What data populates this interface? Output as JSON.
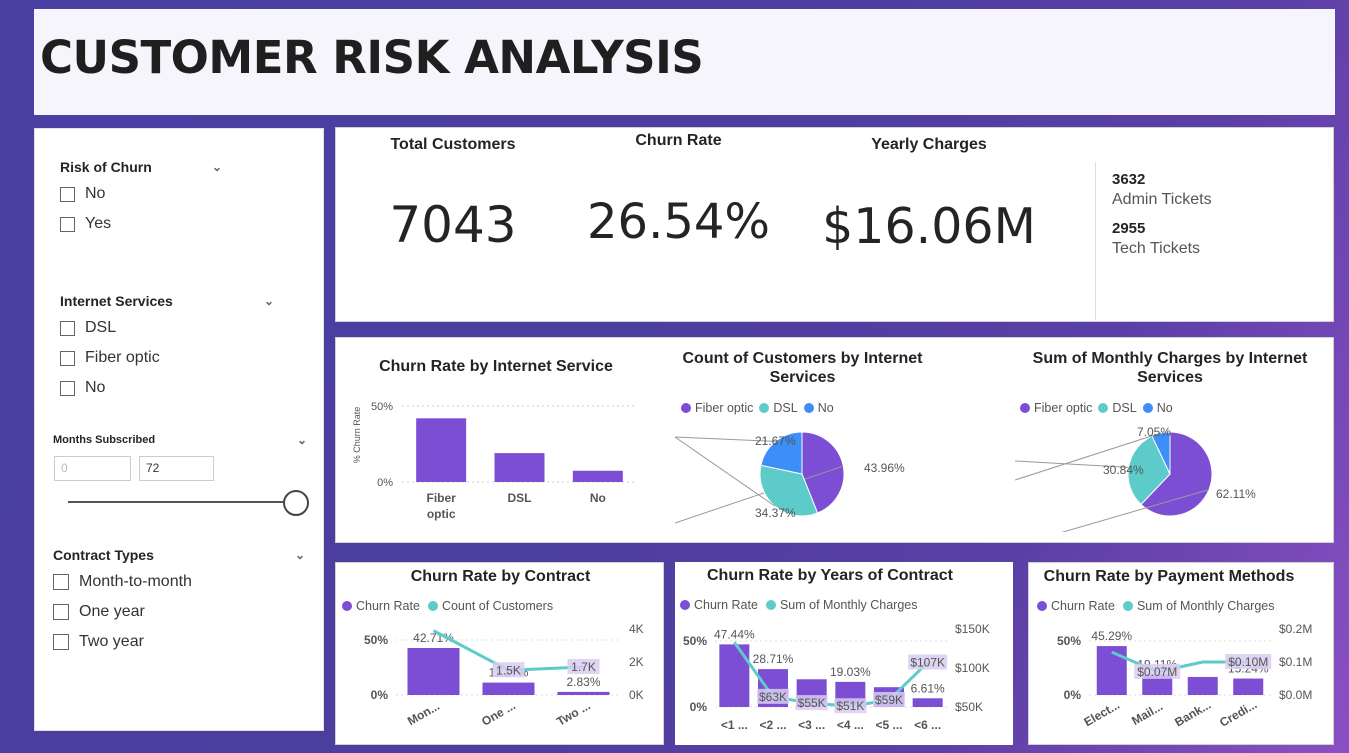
{
  "header": {
    "title": "CUSTOMER RISK ANALYSIS"
  },
  "colors": {
    "purple": "#7b4ed3",
    "teal": "#5ccbc9",
    "blue": "#3e8ef7",
    "lavender": "#d9cdf1"
  },
  "filters": {
    "risk": {
      "title": "Risk of Churn",
      "items": [
        "No",
        "Yes"
      ]
    },
    "internet": {
      "title": "Internet Services",
      "items": [
        "DSL",
        "Fiber optic",
        "No"
      ]
    },
    "months": {
      "title": "Months Subscribed",
      "min_placeholder": "0",
      "max_value": "72"
    },
    "contract": {
      "title": "Contract Types",
      "items": [
        "Month-to-month",
        "One year",
        "Two year"
      ]
    }
  },
  "kpis": {
    "total_customers": {
      "label": "Total Customers",
      "value": "7043"
    },
    "churn_rate": {
      "label": "Churn Rate",
      "value": "26.54%"
    },
    "yearly_charges": {
      "label": "Yearly Charges",
      "value": "$16.06M"
    },
    "tickets": [
      {
        "value": "3632",
        "label": "Admin Tickets"
      },
      {
        "value": "2955",
        "label": "Tech Tickets"
      }
    ]
  },
  "chart_data": [
    {
      "type": "bar",
      "title": "Churn Rate by Internet Service",
      "ylabel": "% Churn Rate",
      "categories": [
        "Fiber optic",
        "DSL",
        "No"
      ],
      "values": [
        41.9,
        19.0,
        7.4
      ],
      "ylim": [
        0,
        50
      ],
      "yticks": [
        "0%",
        "50%"
      ]
    },
    {
      "type": "pie",
      "title": "Count of Customers by Internet Services",
      "legend": [
        "Fiber optic",
        "DSL",
        "No"
      ],
      "values": [
        43.96,
        34.37,
        21.67
      ],
      "labels": [
        "43.96%",
        "34.37%",
        "21.67%"
      ]
    },
    {
      "type": "pie",
      "title": "Sum of Monthly Charges by Internet Services",
      "legend": [
        "Fiber optic",
        "DSL",
        "No"
      ],
      "values": [
        62.11,
        30.84,
        7.05
      ],
      "labels": [
        "62.11%",
        "30.84%",
        "7.05%"
      ]
    },
    {
      "type": "bar",
      "title": "Churn Rate by Contract",
      "legend": [
        "Churn Rate",
        "Count of Customers"
      ],
      "categories": [
        "Mon...",
        "One ...",
        "Two ..."
      ],
      "values": [
        42.71,
        11.27,
        2.83
      ],
      "bar_labels": [
        "42.71%",
        "11.27%",
        "2.83%"
      ],
      "line_values": [
        3.9,
        1.5,
        1.7
      ],
      "line_labels": [
        "",
        "1.5K",
        "1.7K"
      ],
      "yticks": [
        "0%",
        "50%"
      ],
      "y2ticks": [
        "0K",
        "2K",
        "4K"
      ]
    },
    {
      "type": "bar",
      "title": "Churn Rate by Years of Contract",
      "legend": [
        "Churn Rate",
        "Sum of Monthly Charges"
      ],
      "categories": [
        "<1 ...",
        "<2 ...",
        "<3 ...",
        "<4 ...",
        "<5 ...",
        "<6 ..."
      ],
      "values": [
        47.44,
        28.71,
        21.0,
        19.03,
        15.0,
        6.61
      ],
      "bar_labels": [
        "47.44%",
        "28.71%",
        "",
        "19.03%",
        "",
        "6.61%"
      ],
      "line_values": [
        133,
        63,
        55,
        51,
        59,
        107
      ],
      "line_labels": [
        "",
        "$63K",
        "$55K",
        "$51K",
        "$59K",
        "$107K"
      ],
      "yticks": [
        "0%",
        "50%"
      ],
      "y2ticks": [
        "$50K",
        "$100K",
        "$150K"
      ]
    },
    {
      "type": "bar",
      "title": "Churn Rate by Payment Methods",
      "legend": [
        "Churn Rate",
        "Sum of Monthly Charges"
      ],
      "categories": [
        "Elect...",
        "Mail...",
        "Bank...",
        "Credi..."
      ],
      "values": [
        45.29,
        19.11,
        16.7,
        15.24
      ],
      "bar_labels": [
        "45.29%",
        "19.11%",
        "",
        "15.24%"
      ],
      "line_values": [
        0.13,
        0.07,
        0.1,
        0.1
      ],
      "line_labels": [
        "",
        "$0.07M",
        "",
        "$0.10M"
      ],
      "yticks": [
        "0%",
        "50%"
      ],
      "y2ticks": [
        "$0.0M",
        "$0.1M",
        "$0.2M"
      ]
    }
  ]
}
